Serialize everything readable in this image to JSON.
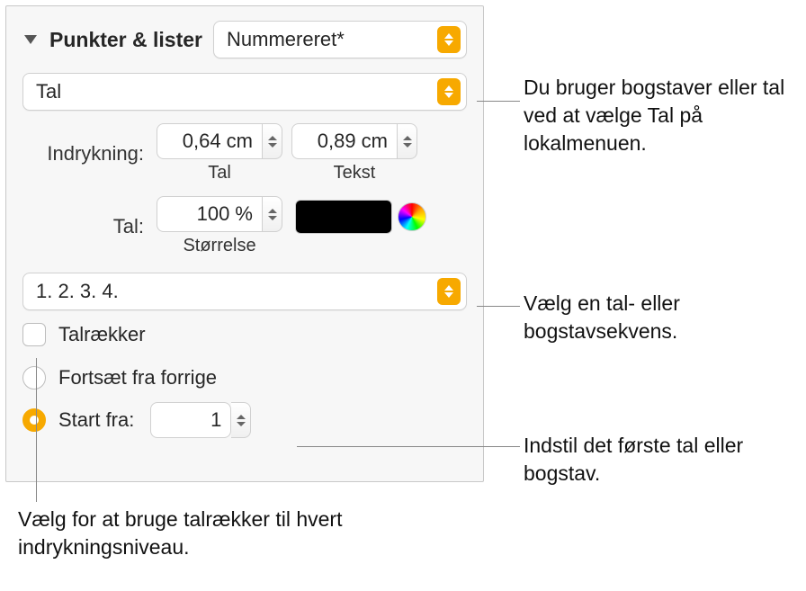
{
  "header": {
    "title": "Punkter & lister"
  },
  "style_popup": {
    "value": "Nummereret*"
  },
  "number_type_popup": {
    "value": "Tal"
  },
  "indent": {
    "label": "Indrykning:",
    "number_value": "0,64 cm",
    "number_caption": "Tal",
    "text_value": "0,89 cm",
    "text_caption": "Tekst"
  },
  "size": {
    "label": "Tal:",
    "value": "100 %",
    "caption": "Størrelse"
  },
  "sequence_popup": {
    "value": "1. 2. 3. 4."
  },
  "tiered": {
    "label": "Talrækker"
  },
  "continue": {
    "label": "Fortsæt fra forrige"
  },
  "start_from": {
    "label": "Start fra:",
    "value": "1"
  },
  "callouts": {
    "c1": "Du bruger bogstaver eller tal ved at vælge Tal på lokalmenuen.",
    "c2": "Vælg en tal- eller bogstavsekvens.",
    "c3": "Indstil det første tal eller bogstav.",
    "c4": "Vælg for at bruge talrækker til hvert indrykningsniveau."
  }
}
